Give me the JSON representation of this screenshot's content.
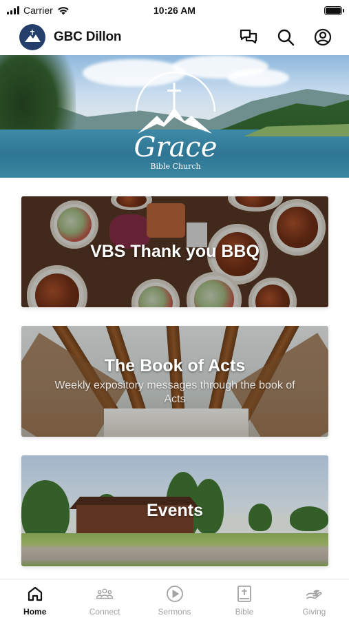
{
  "status_bar": {
    "carrier": "Carrier",
    "time": "10:26 AM"
  },
  "header": {
    "title": "GBC Dillon",
    "icons": [
      "chat-icon",
      "search-icon",
      "account-icon"
    ]
  },
  "hero": {
    "logo_word": "Grace",
    "logo_sub": "Bible Church"
  },
  "cards": [
    {
      "title": "VBS Thank you BBQ",
      "subtitle": ""
    },
    {
      "title": "The Book of Acts",
      "subtitle": "Weekly expository messages through the book of Acts"
    },
    {
      "title": "Events",
      "subtitle": ""
    }
  ],
  "tabs": [
    {
      "label": "Home",
      "icon": "home-icon",
      "active": true
    },
    {
      "label": "Connect",
      "icon": "people-icon",
      "active": false
    },
    {
      "label": "Sermons",
      "icon": "play-icon",
      "active": false
    },
    {
      "label": "Bible",
      "icon": "bible-icon",
      "active": false
    },
    {
      "label": "Giving",
      "icon": "giving-icon",
      "active": false
    }
  ],
  "colors": {
    "accent": "#111111",
    "inactive_tab": "#a2a2a2",
    "logo_bg": "#243f6b"
  }
}
